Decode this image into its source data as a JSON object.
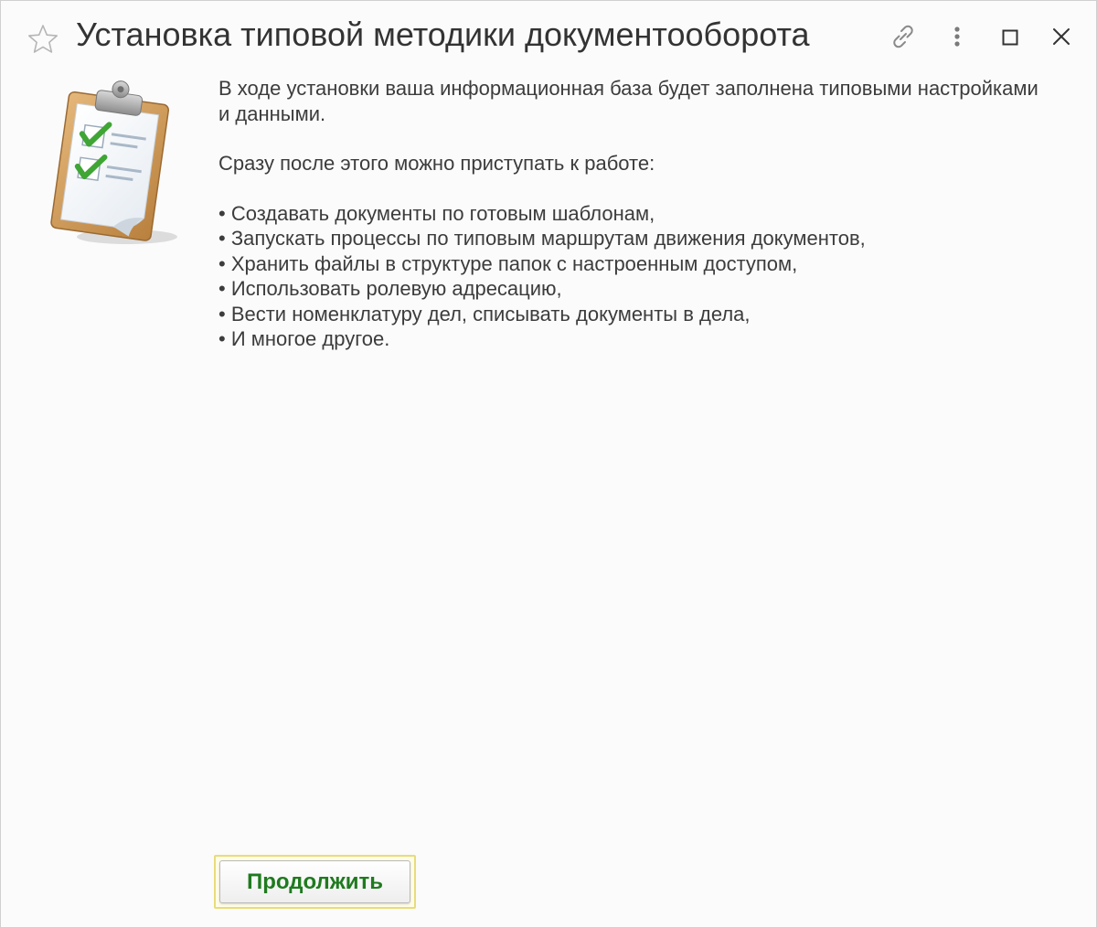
{
  "window": {
    "title": "Установка типовой методики документооборота"
  },
  "icons": {
    "favorite": "star-icon",
    "link": "link-icon",
    "more": "more-vertical-icon",
    "maximize": "maximize-icon",
    "close": "close-icon",
    "illustration": "clipboard-checklist-icon"
  },
  "content": {
    "intro": "В ходе установки ваша информационная база будет заполнена типовыми настройками и данными.",
    "after": "Сразу после этого можно приступать к работе:",
    "bullets": [
      "• Создавать документы по готовым шаблонам,",
      "• Запускать процессы по типовым маршрутам движения документов,",
      "• Хранить файлы в структуре папок с настроенным доступом,",
      "• Использовать ролевую адресацию,",
      "• Вести номенклатуру дел, списывать документы в дела,",
      "• И многое другое."
    ]
  },
  "actions": {
    "continue_label": "Продолжить"
  },
  "colors": {
    "button_text": "#1f7a1f",
    "default_button_frame": "#e8dc7a",
    "check_green": "#3fa535"
  }
}
